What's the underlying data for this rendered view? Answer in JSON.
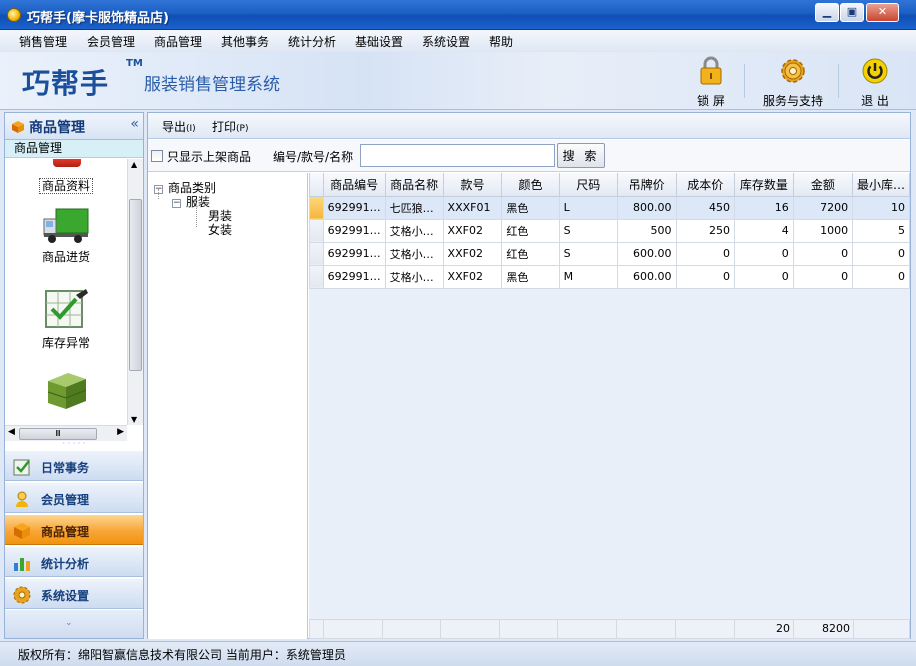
{
  "window": {
    "title": "巧帮手(摩卡服饰精品店)",
    "minimize": "▁",
    "restore": "▣",
    "close": "✕"
  },
  "menu": [
    "销售管理",
    "会员管理",
    "商品管理",
    "其他事务",
    "统计分析",
    "基础设置",
    "系统设置",
    "帮助"
  ],
  "banner": {
    "logo": "巧帮手",
    "tm": "TM",
    "subtitle": "服装销售管理系统",
    "tools": [
      {
        "label": "锁 屏",
        "icon": "lock-icon"
      },
      {
        "label": "服务与支持",
        "icon": "gear-icon"
      },
      {
        "label": "退 出",
        "icon": "power-icon"
      }
    ]
  },
  "left_panel": {
    "title": "商品管理",
    "collapse": "«",
    "sub_title": "商品管理",
    "items": [
      {
        "label": "商品资料",
        "icon": "product-info-icon"
      },
      {
        "label": "商品进货",
        "icon": "truck-icon"
      },
      {
        "label": "库存异常",
        "icon": "inventory-check-icon"
      },
      {
        "label": "",
        "icon": "goods-stack-icon"
      }
    ],
    "scroll_grip": "Ⅲ",
    "nav": [
      {
        "label": "日常事务",
        "icon": "daily-tasks-icon",
        "active": false
      },
      {
        "label": "会员管理",
        "icon": "members-icon",
        "active": false
      },
      {
        "label": "商品管理",
        "icon": "products-icon",
        "active": true
      },
      {
        "label": "统计分析",
        "icon": "statistics-icon",
        "active": false
      },
      {
        "label": "系统设置",
        "icon": "settings-icon",
        "active": false
      }
    ]
  },
  "toolbar": {
    "export": "导出",
    "export_key": "(I)",
    "print": "打印",
    "print_key": "(P)"
  },
  "filter": {
    "only_listed": "只显示上架商品",
    "search_label": "编号/款号/名称",
    "search_value": "",
    "search_button": "搜 索"
  },
  "tree": {
    "root": "商品类别",
    "child": "服装",
    "leaves": [
      "男装",
      "女装"
    ]
  },
  "table": {
    "columns": [
      "商品编号",
      "商品名称",
      "款号",
      "颜色",
      "尺码",
      "吊牌价",
      "成本价",
      "库存数量",
      "金额",
      "最小库…"
    ],
    "rows": [
      [
        "692991…",
        "七匹狼…",
        "XXXF01",
        "黑色",
        "L",
        "800.00",
        "450",
        "16",
        "7200",
        "10"
      ],
      [
        "692991…",
        "艾格小…",
        "XXF02",
        "红色",
        "S",
        "500",
        "250",
        "4",
        "1000",
        "5"
      ],
      [
        "692991…",
        "艾格小…",
        "XXF02",
        "红色",
        "S",
        "600.00",
        "0",
        "0",
        "0",
        "0"
      ],
      [
        "692991…",
        "艾格小…",
        "XXF02",
        "黑色",
        "M",
        "600.00",
        "0",
        "0",
        "0",
        "0"
      ]
    ],
    "totals": {
      "stock": "20",
      "amount": "8200"
    }
  },
  "status": {
    "text": "版权所有：绵阳智赢信息技术有限公司  当前用户：系统管理员"
  }
}
